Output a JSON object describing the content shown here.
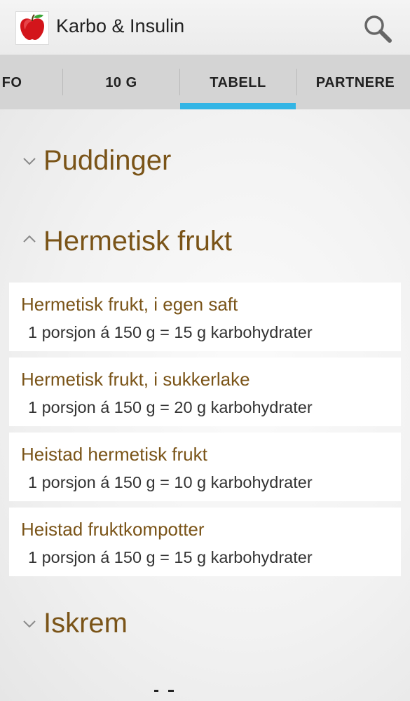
{
  "app": {
    "title": "Karbo & Insulin"
  },
  "tabs": [
    {
      "label": "FO",
      "selected": false
    },
    {
      "label": "10 G",
      "selected": false
    },
    {
      "label": "TABELL",
      "selected": true
    },
    {
      "label": "PARTNERE",
      "selected": false
    }
  ],
  "sections": [
    {
      "title": "Puddinger",
      "expanded": false
    },
    {
      "title": "Hermetisk frukt",
      "expanded": true,
      "items": [
        {
          "name": "Hermetisk frukt, i egen saft",
          "detail": "1 porsjon á 150 g = 15 g karbohydrater"
        },
        {
          "name": "Hermetisk frukt, i sukkerlake",
          "detail": "1 porsjon á 150 g = 20 g karbohydrater"
        },
        {
          "name": "Heistad hermetisk frukt",
          "detail": "1 porsjon á 150 g = 10 g karbohydrater"
        },
        {
          "name": "Heistad fruktkompotter",
          "detail": "1 porsjon á 150 g = 15 g karbohydrater"
        }
      ]
    },
    {
      "title": "Iskrem",
      "expanded": false
    }
  ],
  "colors": {
    "accent": "#33b5e5",
    "heading": "#7a5418",
    "tab_bar": "#d4d4d4"
  },
  "icons": {
    "app": "apple-icon",
    "search": "search-icon",
    "collapsed": "chevron-down-icon",
    "expanded": "chevron-up-icon"
  }
}
